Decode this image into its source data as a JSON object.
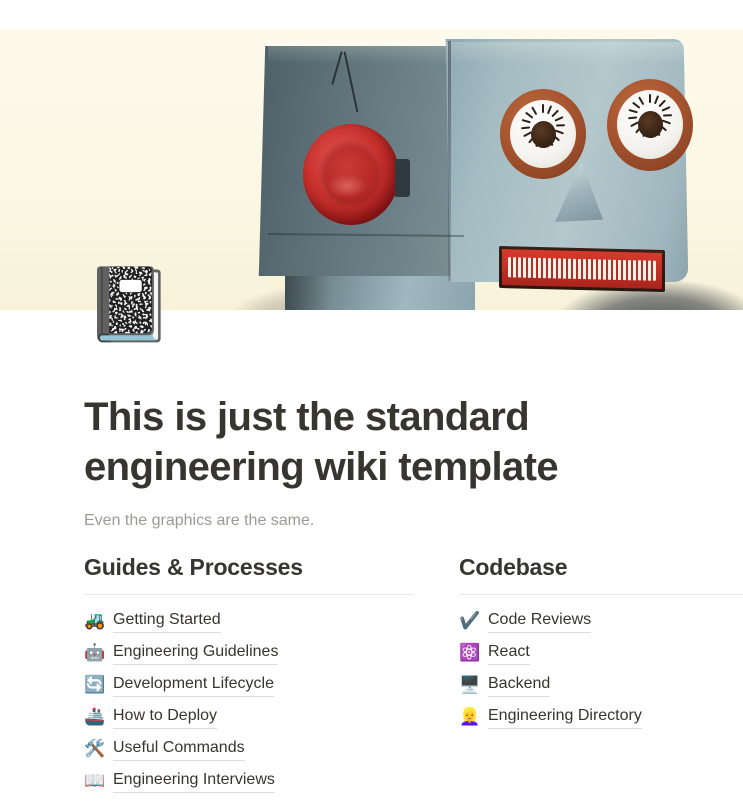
{
  "hero": {
    "alt": "vintage tin toy robot head on cream background",
    "background_color": "#fcf9e8",
    "robot_head_color": "#a4bcc2",
    "robot_knob_color": "#c8312d",
    "robot_mouth_color": "#c12f24"
  },
  "page_icon": "📓",
  "title": "This is just the standard engineering wiki template",
  "subtitle": "Even the graphics are the same.",
  "columns": [
    {
      "heading": "Guides & Processes",
      "links": [
        {
          "emoji": "🚜",
          "icon_name": "tractor-icon",
          "label": "Getting Started"
        },
        {
          "emoji": "🤖",
          "icon_name": "robot-icon",
          "label": "Engineering Guidelines"
        },
        {
          "emoji": "🔄",
          "icon_name": "recycle-arrows-icon",
          "label": "Development Lifecycle"
        },
        {
          "emoji": "🚢",
          "icon_name": "ship-icon",
          "label": "How to Deploy"
        },
        {
          "emoji": "🛠️",
          "icon_name": "hammer-and-wrench-icon",
          "label": "Useful Commands"
        },
        {
          "emoji": "📖",
          "icon_name": "open-book-icon",
          "label": "Engineering Interviews"
        }
      ]
    },
    {
      "heading": "Codebase",
      "links": [
        {
          "emoji": "✔️",
          "icon_name": "check-mark-icon",
          "label": "Code Reviews"
        },
        {
          "emoji": "⚛️",
          "icon_name": "atom-react-icon",
          "label": "React"
        },
        {
          "emoji": "🖥️",
          "icon_name": "desktop-computer-icon",
          "label": "Backend"
        },
        {
          "emoji": "👱‍♀️",
          "icon_name": "person-blond-hair-icon",
          "label": "Engineering Directory"
        }
      ]
    }
  ],
  "colors": {
    "text": "#37352f",
    "muted": "#9b9a97",
    "rule": "#e9e9e7",
    "underline": "#dfdedb"
  }
}
